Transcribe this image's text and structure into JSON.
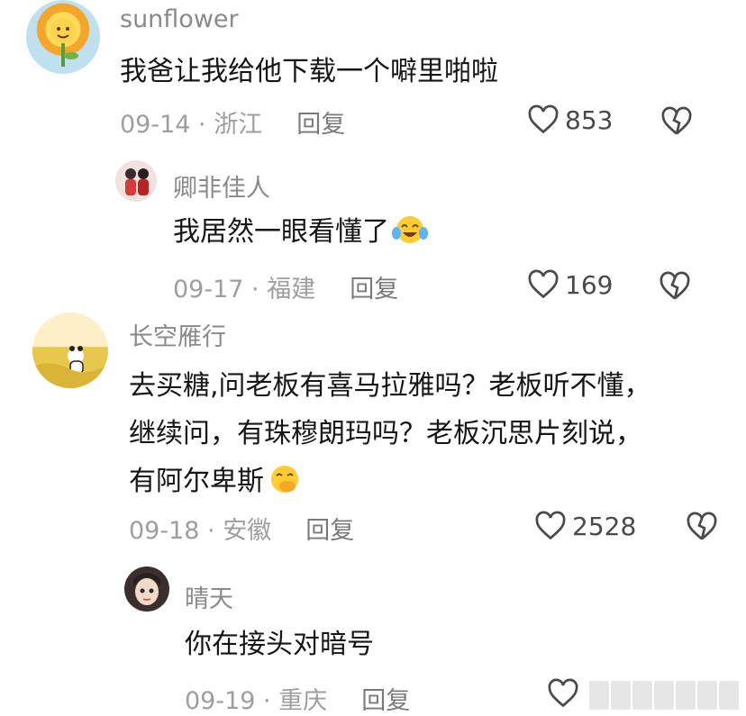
{
  "comments": [
    {
      "username": "sunflower",
      "text": [
        "我爸让我给他下载一个噼里啪啦"
      ],
      "date": "09-14",
      "location": "浙江",
      "reply_label": "回复",
      "likes": "853"
    },
    {
      "username": "卿非佳人",
      "text": [
        "我居然一眼看懂了"
      ],
      "date": "09-17",
      "location": "福建",
      "reply_label": "回复",
      "likes": "169"
    },
    {
      "username": "长空雁行",
      "text": [
        "去买糖,问老板有喜马拉雅吗？老板听不懂，",
        "继续问，有珠穆朗玛吗？老板沉思片刻说，",
        "有阿尔卑斯"
      ],
      "date": "09-18",
      "location": "安徽",
      "reply_label": "回复",
      "likes": "2528"
    },
    {
      "username": "晴天",
      "text": [
        "你在接头对暗号"
      ],
      "date": "09-19",
      "location": "重庆",
      "reply_label": "回复",
      "likes": ""
    }
  ],
  "separator": " · ",
  "icons": {
    "like": "heart-outline-icon",
    "dislike": "broken-heart-icon",
    "emoji_cry": "crying-laughing-emoji",
    "emoji_smirk": "hand-over-mouth-emoji"
  },
  "colors": {
    "username": "#8a8a8a",
    "meta": "#9e9e9e",
    "text": "#161616"
  }
}
